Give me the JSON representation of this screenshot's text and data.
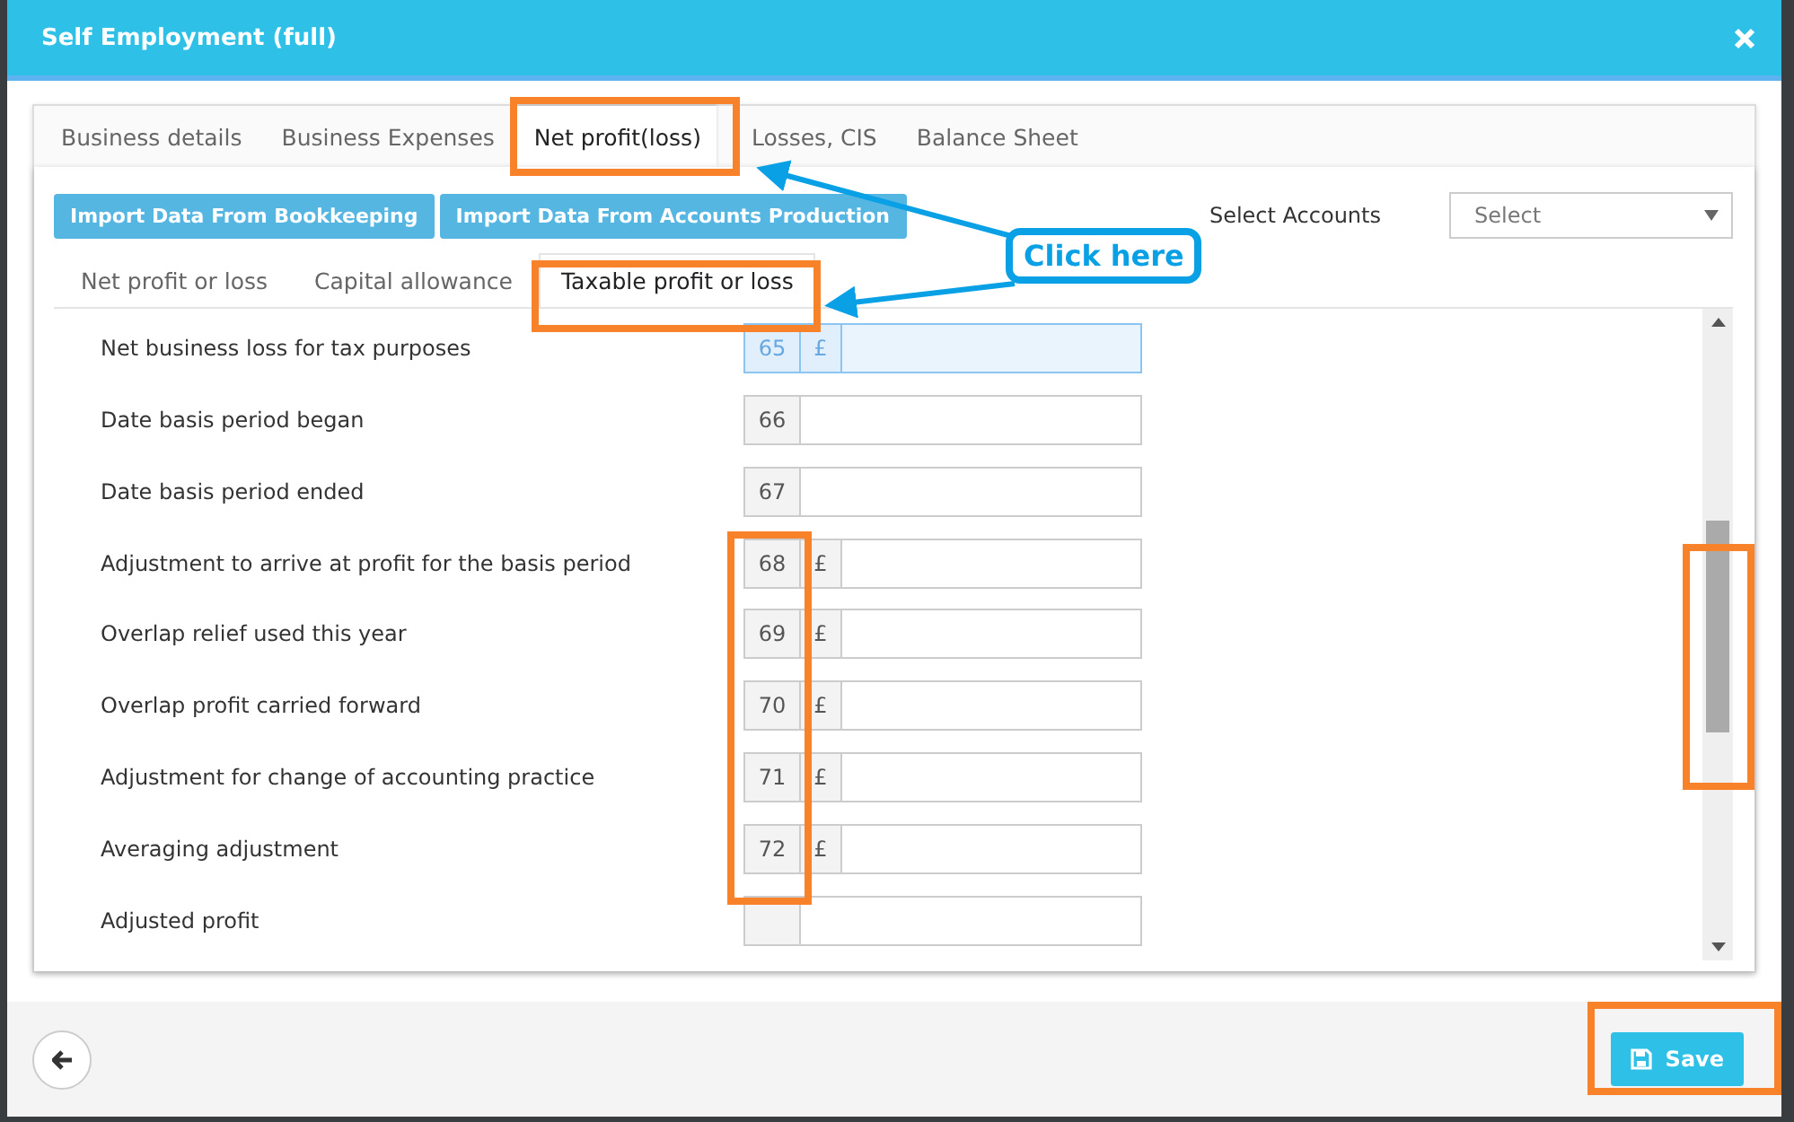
{
  "window": {
    "title": "Self Employment (full)"
  },
  "tabs": [
    {
      "label": "Business details",
      "selected": false
    },
    {
      "label": "Business Expenses",
      "selected": false
    },
    {
      "label": "Net profit(loss)",
      "selected": true
    },
    {
      "label": "Losses, CIS",
      "selected": false
    },
    {
      "label": "Balance Sheet",
      "selected": false
    }
  ],
  "import_buttons": [
    "Import Data From Bookkeeping",
    "Import Data From Accounts Production"
  ],
  "select_accounts": {
    "label": "Select Accounts",
    "placeholder": "Select"
  },
  "subtabs": [
    {
      "label": "Net profit or loss",
      "selected": false
    },
    {
      "label": "Capital allowance",
      "selected": false
    },
    {
      "label": "Taxable profit or loss",
      "selected": true
    }
  ],
  "rows": [
    {
      "label": "Net business loss for tax purposes",
      "number": "65",
      "currency": "£",
      "focused": true
    },
    {
      "label": "Date basis period began",
      "number": "66",
      "focused": false
    },
    {
      "label": "Date basis period ended",
      "number": "67",
      "focused": false
    },
    {
      "label": "Adjustment to arrive at profit for the basis period",
      "number": "68",
      "currency": "£",
      "focused": false
    },
    {
      "label": "Overlap relief used this year",
      "number": "69",
      "currency": "£",
      "focused": false
    },
    {
      "label": "Overlap profit carried forward",
      "number": "70",
      "currency": "£",
      "focused": false
    },
    {
      "label": "Adjustment for change of accounting practice",
      "number": "71",
      "currency": "£",
      "focused": false
    },
    {
      "label": "Averaging adjustment",
      "number": "72",
      "currency": "£",
      "focused": false
    },
    {
      "label": "Adjusted profit",
      "focused": false
    }
  ],
  "footer": {
    "save": "Save"
  },
  "annotation": {
    "callout": "Click here"
  }
}
